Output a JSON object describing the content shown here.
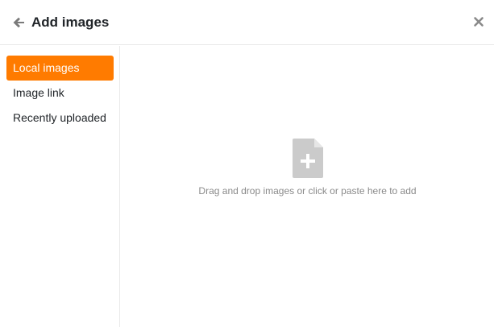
{
  "dialog": {
    "title": "Add images",
    "back_icon": "arrow-left-icon",
    "close_icon": "close-icon"
  },
  "sidebar": {
    "items": [
      {
        "label": "Local images",
        "active": true
      },
      {
        "label": "Image link",
        "active": false
      },
      {
        "label": "Recently uploaded",
        "active": false
      }
    ]
  },
  "main": {
    "upload_icon": "file-plus-icon",
    "drop_hint": "Drag and drop images or click or paste here to add"
  },
  "colors": {
    "accent": "#ff7b00",
    "icon_gray": "#c9c9c9",
    "hint_text": "#8a8a8a"
  }
}
